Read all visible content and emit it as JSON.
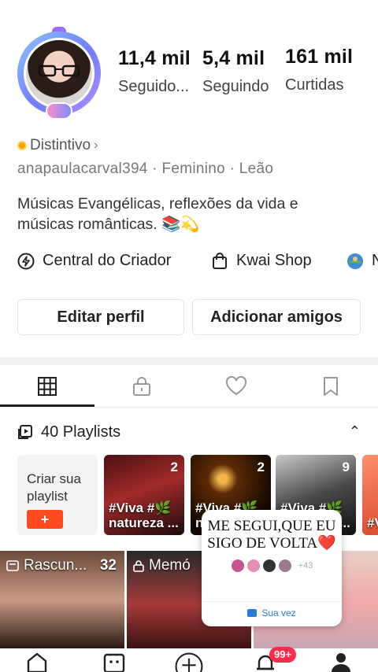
{
  "profile": {
    "stats": [
      {
        "value": "11,4 mil",
        "label": "Seguido..."
      },
      {
        "value": "5,4 mil",
        "label": "Seguindo"
      },
      {
        "value": "161 mil",
        "label": "Curtidas"
      }
    ],
    "badge_label": "Distintivo",
    "meta": "anapaulacarval394 · Feminino · Leão",
    "bio": "Músicas Evangélicas, reflexões da vida e músicas românticas. 📚💫",
    "links": [
      {
        "label": "Central do Criador",
        "icon": "lightning-circle-icon"
      },
      {
        "label": "Kwai Shop",
        "icon": "shopping-bag-icon"
      },
      {
        "label": "N",
        "icon": "globe-avatar-icon"
      }
    ],
    "edit_button": "Editar perfil",
    "add_friends_button": "Adicionar amigos"
  },
  "tabs": [
    {
      "icon": "grid-icon",
      "active": true
    },
    {
      "icon": "lock-icon",
      "active": false
    },
    {
      "icon": "heart-icon",
      "active": false
    },
    {
      "icon": "bookmark-icon",
      "active": false
    }
  ],
  "playlists": {
    "header": "40 Playlists",
    "create_label": "Criar sua playlist",
    "create_plus": "+",
    "items": [
      {
        "count": "2",
        "title": "#Viva #🌿 natureza ..."
      },
      {
        "count": "2",
        "title": "#Viva #🌿 natureza ..."
      },
      {
        "count": "9",
        "title": "#Viva #🌿 natureza ..."
      },
      {
        "count": "",
        "title": "#V"
      }
    ]
  },
  "videos": [
    {
      "label": "Rascun...",
      "count": "32"
    },
    {
      "label": "Memó",
      "count": ""
    },
    {
      "label": "",
      "count": ""
    }
  ],
  "popup": {
    "text": "ME SEGUI,QUE EU SIGO DE VOLTA❤️",
    "more": "+43",
    "action": "Sua vez"
  },
  "bottom_nav": {
    "items": [
      "home-icon",
      "friends-icon",
      "create-icon",
      "notifications-icon",
      "profile-icon"
    ],
    "notification_badge": "99+"
  },
  "colors": {
    "accent": "#ff4b1f",
    "badge": "#ff2d4b",
    "link_blue": "#2b7bd6"
  }
}
